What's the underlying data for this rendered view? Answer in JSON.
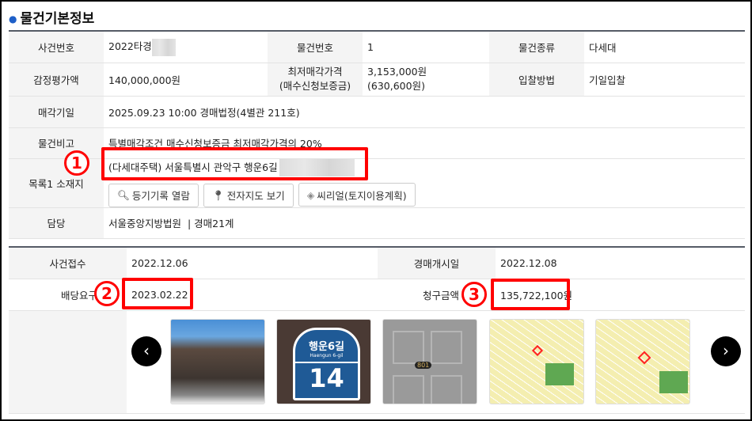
{
  "title": "물건기본정보",
  "basic": {
    "case_no_label": "사건번호",
    "case_no": "2022타경",
    "item_no_label": "물건번호",
    "item_no": "1",
    "item_type_label": "물건종류",
    "item_type": "다세대",
    "appraisal_label": "감정평가액",
    "appraisal": "140,000,000원",
    "min_price_label_1": "최저매각가격",
    "min_price_label_2": "(매수신청보증금)",
    "min_price": "3,153,000원",
    "deposit": "(630,600원)",
    "bid_method_label": "입찰방법",
    "bid_method": "기일입찰",
    "sale_date_label": "매각기일",
    "sale_date": "2025.09.23 10:00 경매법정(4별관 211호)",
    "remark_label": "물건비고",
    "remark": "특별매각조건 매수신청보증금 최저매각가격의 20%",
    "address_label": "목록1 소재지",
    "address": "(다세대주택) 서울특별시 관악구 행운6길",
    "buttons": [
      "등기기록 열람",
      "전자지도 보기",
      "씨리얼(토지이용계획)"
    ],
    "charge_label": "담당",
    "charge": "서울중앙지방법원  | 경매21계"
  },
  "detail": {
    "filed_label": "사건접수",
    "filed": "2022.12.06",
    "start_label": "경매개시일",
    "start": "2022.12.08",
    "deadline_label": "배당요구종기",
    "deadline": "2023.02.22",
    "claim_label": "청구금액",
    "claim": "135,722,100원"
  },
  "annotations": [
    "1",
    "2",
    "3"
  ],
  "photos": {
    "sign_text": "행운6길",
    "sign_sub": "Haengun 6-gil",
    "sign_num": "14",
    "door_num": "801"
  },
  "colors": {
    "highlight": "#ff0000",
    "accent": "#1e5fc8"
  }
}
